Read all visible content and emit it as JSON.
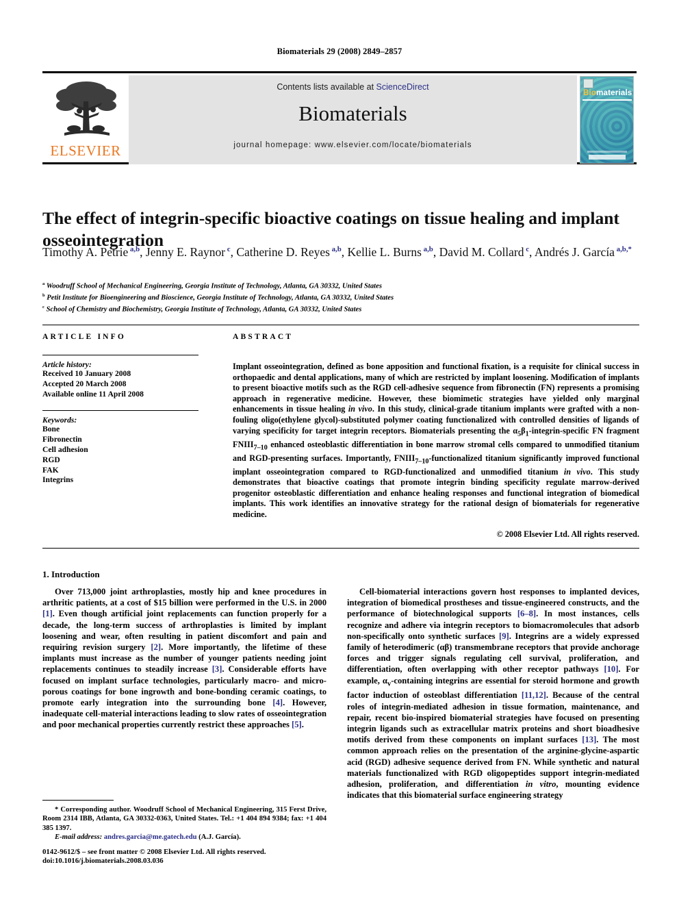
{
  "running_head": "Biomaterials 29 (2008) 2849–2857",
  "masthead": {
    "publisher_name": "ELSEVIER",
    "contents_prefix": "Contents lists available at ",
    "contents_link": "ScienceDirect",
    "journal_name": "Biomaterials",
    "homepage": "journal homepage: www.elsevier.com/locate/biomaterials",
    "cover": {
      "title_part1": "Bio",
      "title_part2": "materials"
    }
  },
  "article": {
    "title": "The effect of integrin-specific bioactive coatings on tissue healing and implant osseointegration",
    "authors": [
      {
        "name": "Timothy A. Petrie",
        "marks": "a,b",
        "sep": ", "
      },
      {
        "name": "Jenny E. Raynor",
        "marks": "c",
        "sep": ", "
      },
      {
        "name": "Catherine D. Reyes",
        "marks": "a,b",
        "sep": ", "
      },
      {
        "name": "Kellie L. Burns",
        "marks": "a,b",
        "sep": ", "
      },
      {
        "name": "David M. Collard",
        "marks": "c",
        "sep": ", "
      },
      {
        "name": "Andrés J. García",
        "marks": "a,b,*",
        "sep": ""
      }
    ],
    "affiliations": [
      {
        "mark": "a",
        "text": "Woodruff School of Mechanical Engineering, Georgia Institute of Technology, Atlanta, GA 30332, United States"
      },
      {
        "mark": "b",
        "text": "Petit Institute for Bioengineering and Bioscience, Georgia Institute of Technology, Atlanta, GA 30332, United States"
      },
      {
        "mark": "c",
        "text": "School of Chemistry and Biochemistry, Georgia Institute of Technology, Atlanta, GA 30332, United States"
      }
    ]
  },
  "headers": {
    "article_info": "ARTICLE INFO",
    "abstract": "ABSTRACT"
  },
  "article_info": {
    "history_label": "Article history:",
    "history": [
      "Received 10 January 2008",
      "Accepted 20 March 2008",
      "Available online 11 April 2008"
    ],
    "keywords_label": "Keywords:",
    "keywords": [
      "Bone",
      "Fibronectin",
      "Cell adhesion",
      "RGD",
      "FAK",
      "Integrins"
    ]
  },
  "abstract": {
    "paragraph": "Implant osseointegration, defined as bone apposition and functional fixation, is a requisite for clinical success in orthopaedic and dental applications, many of which are restricted by implant loosening. Modification of implants to present bioactive motifs such as the RGD cell-adhesive sequence from fibronectin (FN) represents a promising approach in regenerative medicine. However, these biomimetic strategies have yielded only marginal enhancements in tissue healing in vivo. In this study, clinical-grade titanium implants were grafted with a non-fouling oligo(ethylene glycol)-substituted polymer coating functionalized with controlled densities of ligands of varying specificity for target integrin receptors. Biomaterials presenting the α5β1-integrin-specific FN fragment FNIII7-10 enhanced osteoblastic differentiation in bone marrow stromal cells compared to unmodified titanium and RGD-presenting surfaces. Importantly, FNIII7-10-functionalized titanium significantly improved functional implant osseointegration compared to RGD-functionalized and unmodified titanium in vivo. This study demonstrates that bioactive coatings that promote integrin binding specificity regulate marrow-derived progenitor osteoblastic differentiation and enhance healing responses and functional integration of biomedical implants. This work identifies an innovative strategy for the rational design of biomaterials for regenerative medicine.",
    "copyright": "© 2008 Elsevier Ltd. All rights reserved."
  },
  "section": {
    "heading": "1. Introduction",
    "left_paragraph_1": "Over 713,000 joint arthroplasties, mostly hip and knee procedures in arthritic patients, at a cost of $15 billion were performed in the U.S. in 2000 [1]. Even though artificial joint replacements can function properly for a decade, the long-term success of arthroplasties is limited by implant loosening and wear, often resulting in patient discomfort and pain and requiring revision surgery [2]. More importantly, the lifetime of these implants must increase as the number of younger patients needing joint replacements continues to steadily increase [3]. Considerable efforts have focused on implant surface technologies, particularly macro- and micro-porous coatings for bone ingrowth and bone-bonding ceramic coatings, to promote early integration into the surrounding bone [4]. However, inadequate cell-material interactions leading to slow rates of osseointegration and poor mechanical properties currently restrict these approaches [5].",
    "right_paragraph_1": "Cell-biomaterial interactions govern host responses to implanted devices, integration of biomedical prostheses and tissue-engineered constructs, and the performance of biotechnological supports [6–8]. In most instances, cells recognize and adhere via integrin receptors to biomacromolecules that adsorb non-specifically onto synthetic surfaces [9]. Integrins are a widely expressed family of heterodimeric (αβ) transmembrane receptors that provide anchorage forces and trigger signals regulating cell survival, proliferation, and differentiation, often overlapping with other receptor pathways [10]. For example, αv-containing integrins are essential for steroid hormone and growth factor induction of osteoblast differentiation [11,12]. Because of the central roles of integrin-mediated adhesion in tissue formation, maintenance, and repair, recent bio-inspired biomaterial strategies have focused on presenting integrin ligands such as extracellular matrix proteins and short bioadhesive motifs derived from these components on implant surfaces [13]. The most common approach relies on the presentation of the arginine-glycine-aspartic acid (RGD) adhesive sequence derived from FN. While synthetic and natural materials functionalized with RGD oligopeptides support integrin-mediated adhesion, proliferation, and differentiation in vitro, mounting evidence indicates that this biomaterial surface engineering strategy"
  },
  "footnote": {
    "corresponding": "* Corresponding author. Woodruff School of Mechanical Engineering, 315 Ferst Drive, Room 2314 IBB, Atlanta, GA 30332-0363, United States. Tel.: +1 404 894 9384; fax: +1 404 385 1397.",
    "email_label": "E-mail address:",
    "email": "andres.garcia@me.gatech.edu",
    "email_suffix": "(A.J. García)."
  },
  "bottom_matter": {
    "issn_line": "0142-9612/$ – see front matter © 2008 Elsevier Ltd. All rights reserved.",
    "doi_line": "doi:10.1016/j.biomaterials.2008.03.036"
  },
  "colors": {
    "link": "#2b2f86",
    "elsevier_orange": "#E87722",
    "masthead_band": "#e3e3e3",
    "cover_teal": "#2f9aa8"
  }
}
